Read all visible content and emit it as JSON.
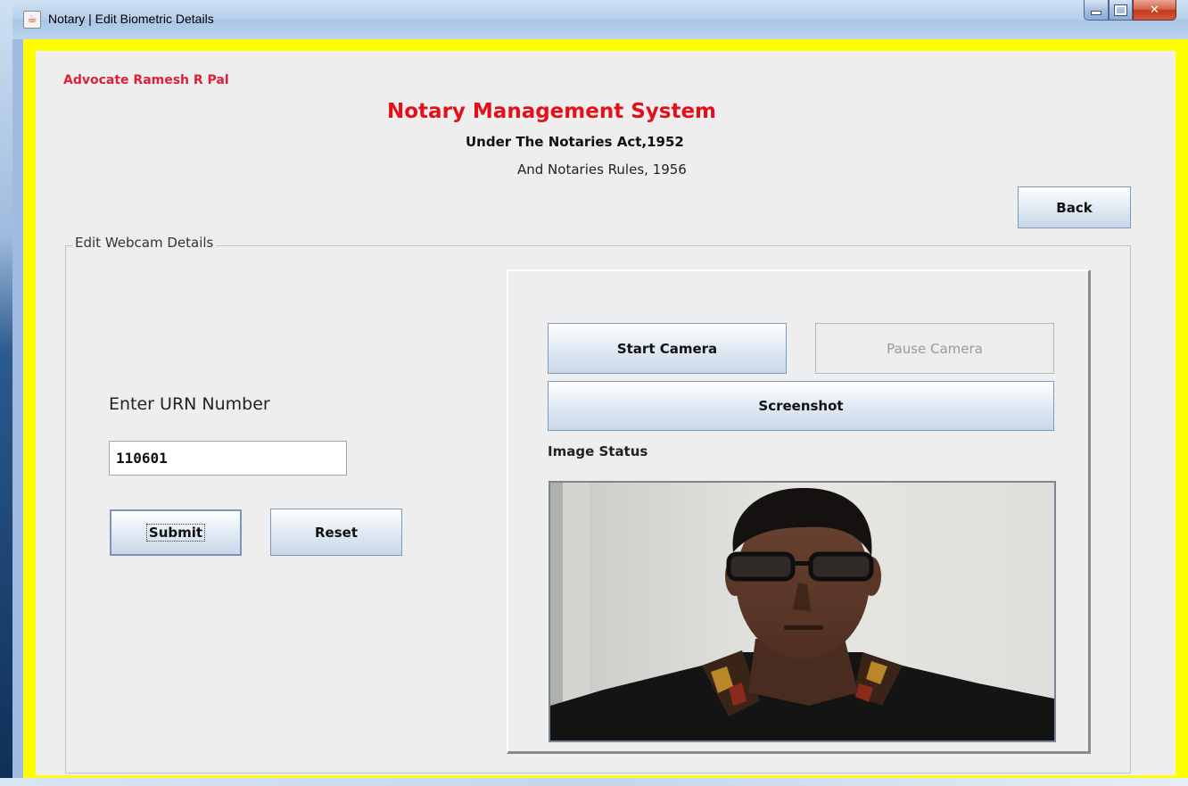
{
  "window": {
    "title": "Notary | Edit Biometric Details"
  },
  "header": {
    "advocate": "Advocate Ramesh R Pal",
    "title": "Notary Management System",
    "subtitle1": "Under The Notaries Act,1952",
    "subtitle2": "And Notaries Rules, 1956"
  },
  "buttons": {
    "back": "Back",
    "submit": "Submit",
    "reset": "Reset",
    "start_camera": "Start Camera",
    "pause_camera": "Pause Camera",
    "screenshot": "Screenshot"
  },
  "form": {
    "legend": "Edit Webcam Details",
    "urn_label": "Enter URN Number",
    "urn_value": "110601"
  },
  "camera": {
    "image_status_label": "Image Status",
    "pause_enabled": false
  },
  "colors": {
    "frame": "#ffff00",
    "title_red": "#e3101c",
    "advocate_red": "#dd1f3a",
    "panel_bg": "#eeeeee"
  },
  "icons": {
    "app": "java-app-icon",
    "minimize": "minimize-icon",
    "maximize": "maximize-icon",
    "close": "close-icon"
  }
}
